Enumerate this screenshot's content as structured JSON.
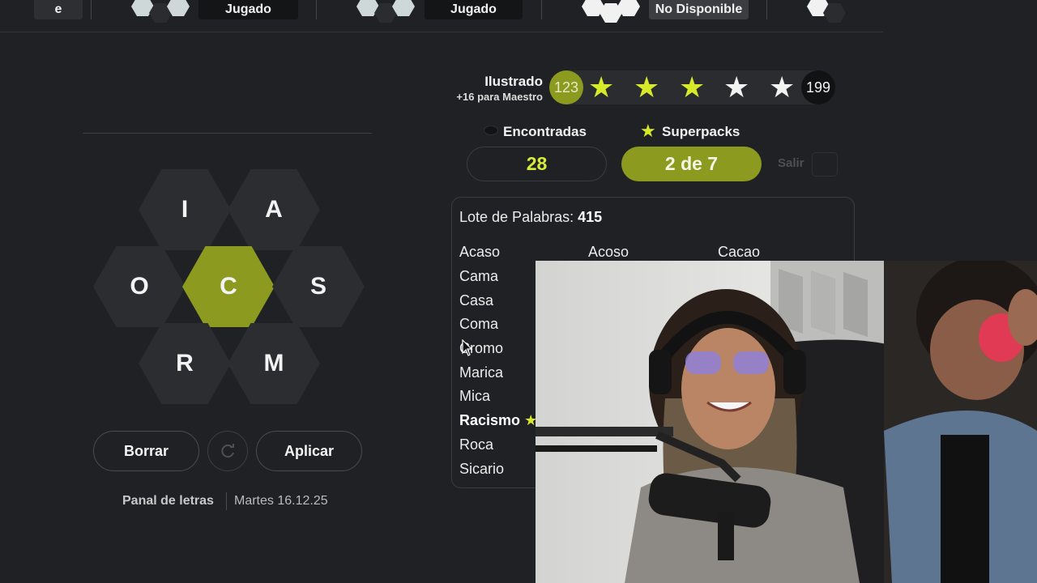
{
  "topbar": {
    "partial_label": "e",
    "badges": [
      "Jugado",
      "Jugado",
      "No Disponible"
    ]
  },
  "board": {
    "letters": {
      "top_left": "I",
      "top_right": "A",
      "left": "O",
      "center": "C",
      "right": "S",
      "bottom_left": "R",
      "bottom_right": "M"
    },
    "delete_label": "Borrar",
    "apply_label": "Aplicar",
    "refresh_icon": "refresh-icon"
  },
  "footer": {
    "game_name": "Panal de letras",
    "date": "Martes 16.12.25"
  },
  "rank": {
    "title": "Ilustrado",
    "subtitle": "+16 para Maestro",
    "current": "123",
    "max": "199",
    "stars_filled": 3,
    "stars_total": 5
  },
  "stats": {
    "found_label": "Encontradas",
    "found_count": "28",
    "superpacks_label": "Superpacks",
    "superpacks_value": "2 de 7",
    "exit_label": "Salir"
  },
  "words": {
    "lote_label": "Lote de Palabras:",
    "lote_count": "415",
    "col2": [
      "Acoso"
    ],
    "col3": [
      "Cacao"
    ],
    "col1": [
      "Acaso",
      "Cama",
      "Casa",
      "Coma",
      "Cromo",
      "Marica",
      "Mica",
      "Racismo",
      "Roca",
      "Sicario"
    ]
  },
  "colors": {
    "accent": "#8c9b1f",
    "highlight": "#d6ea2a",
    "background": "#202124",
    "hex_tile": "#2b2d30"
  }
}
